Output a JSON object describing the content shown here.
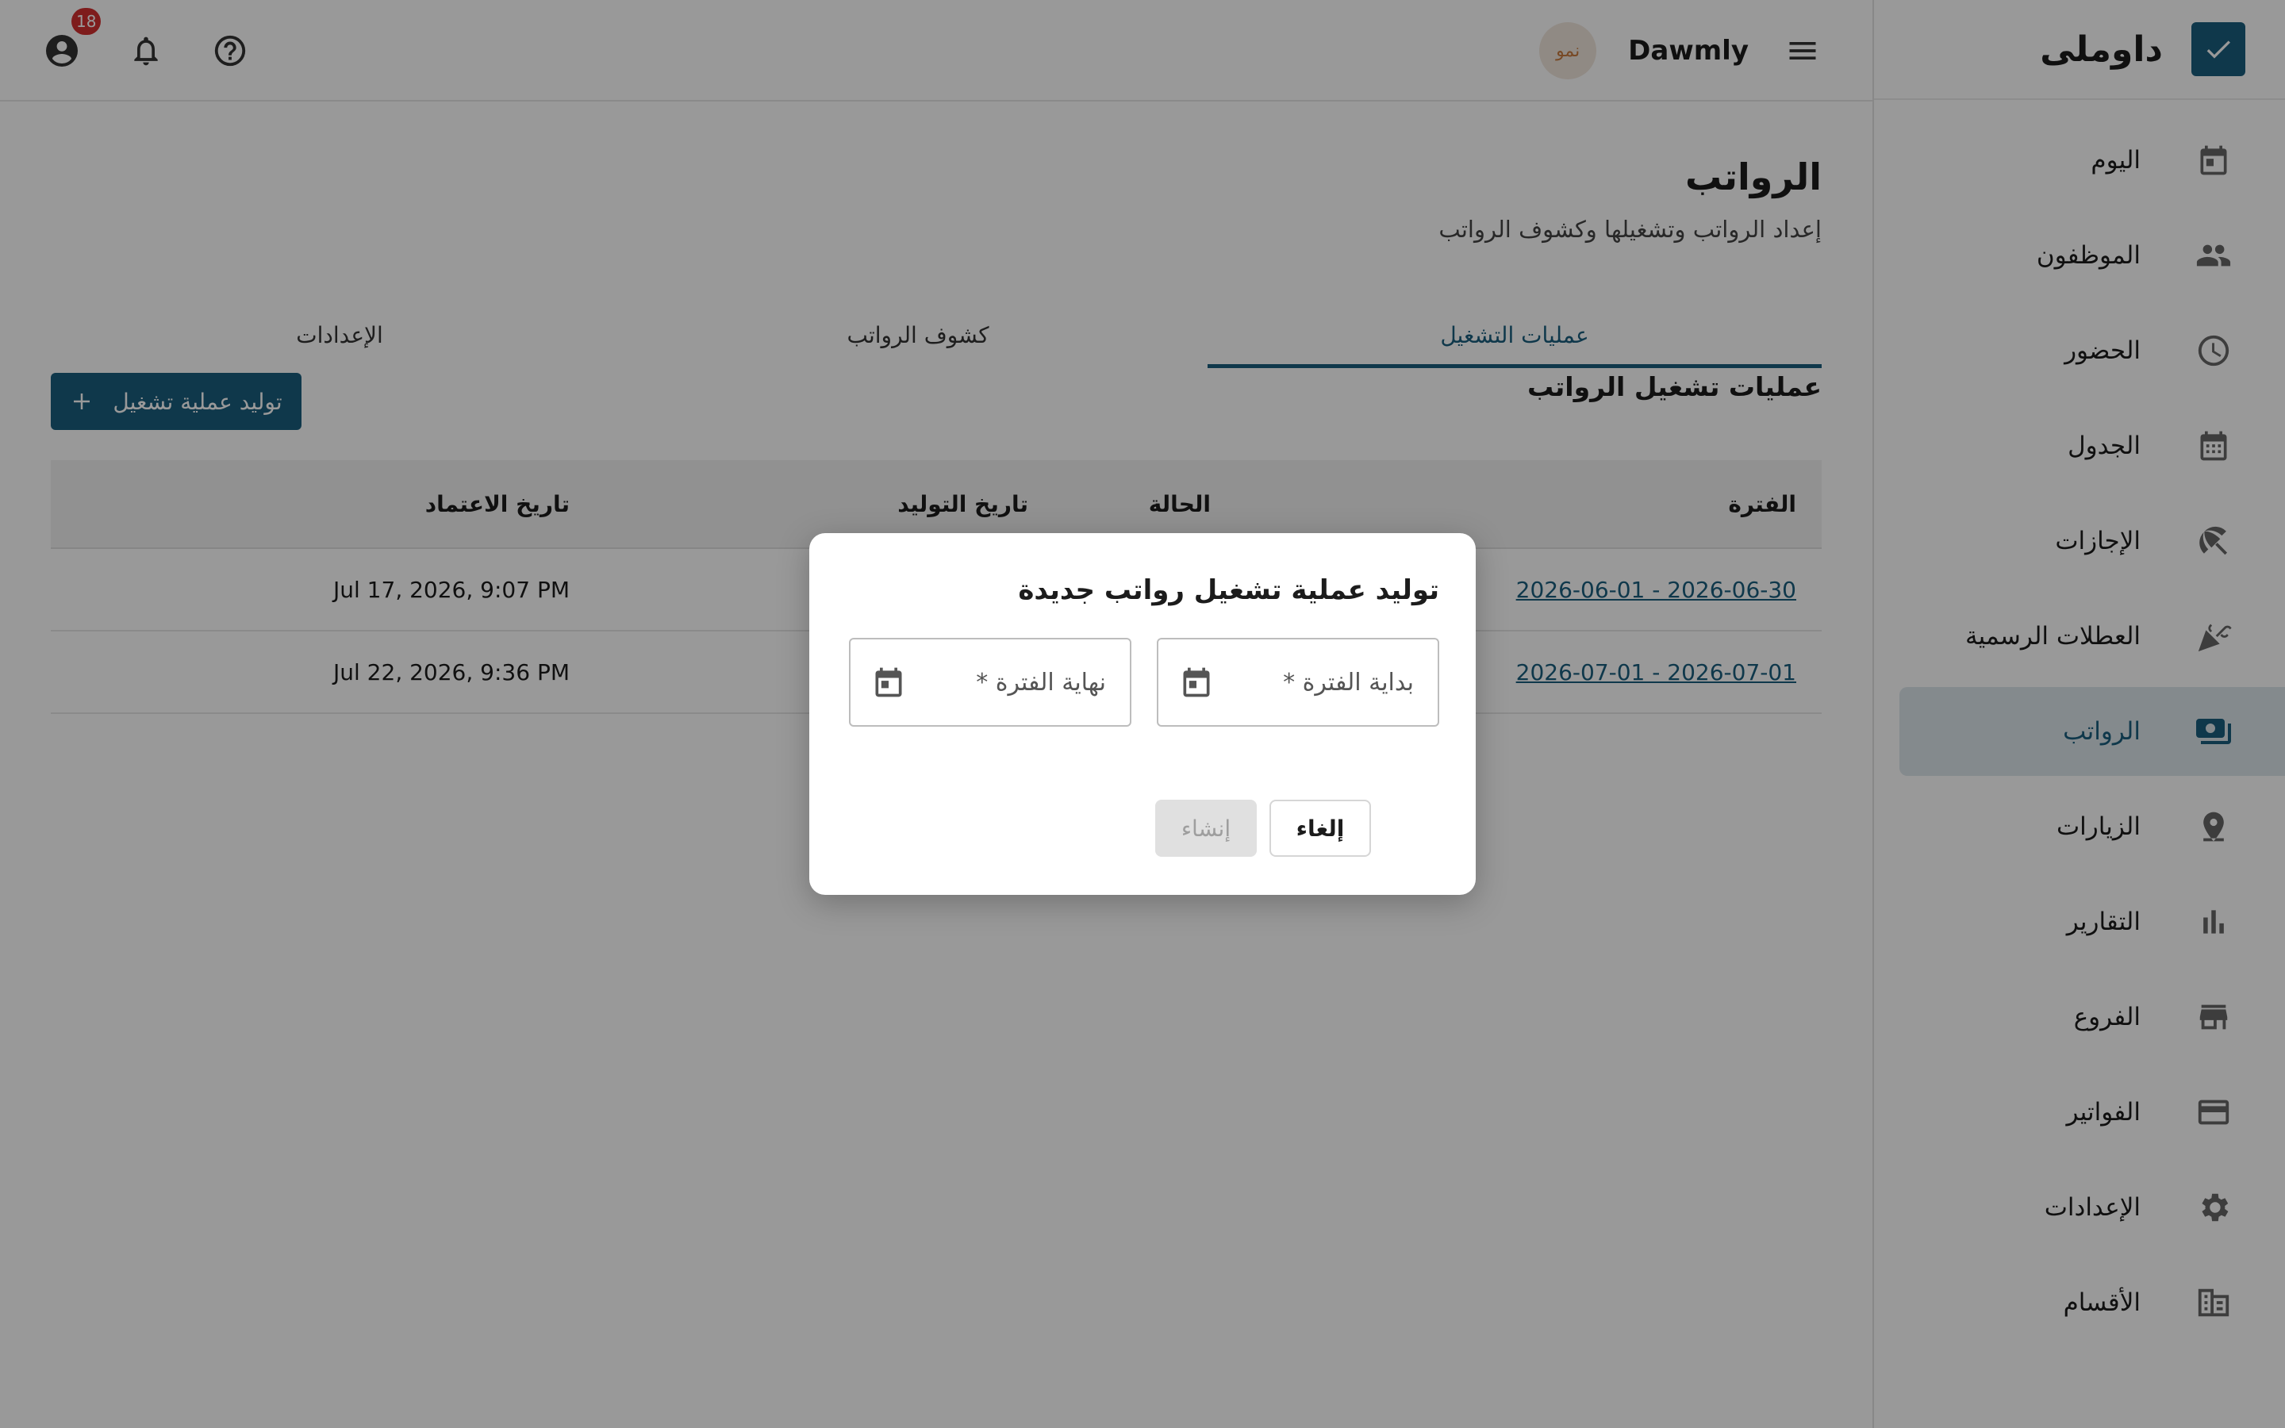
{
  "sidebar": {
    "brand": "داوملى",
    "items": [
      {
        "label": "اليوم",
        "icon": "calendar-today-icon"
      },
      {
        "label": "الموظفون",
        "icon": "people-icon"
      },
      {
        "label": "الحضور",
        "icon": "clock-icon"
      },
      {
        "label": "الجدول",
        "icon": "calendar-grid-icon"
      },
      {
        "label": "الإجازات",
        "icon": "beach-umbrella-icon"
      },
      {
        "label": "العطلات الرسمية",
        "icon": "celebration-icon"
      },
      {
        "label": "الرواتب",
        "icon": "payments-icon",
        "active": true
      },
      {
        "label": "الزيارات",
        "icon": "location-pin-icon"
      },
      {
        "label": "التقارير",
        "icon": "bar-chart-icon"
      },
      {
        "label": "الفروع",
        "icon": "store-icon"
      },
      {
        "label": "الفواتير",
        "icon": "credit-card-icon"
      },
      {
        "label": "الإعدادات",
        "icon": "gear-icon"
      },
      {
        "label": "الأقسام",
        "icon": "building-icon"
      }
    ]
  },
  "topbar": {
    "org_name": "Dawmly",
    "org_avatar_text": "نمو",
    "notification_count": "18"
  },
  "page": {
    "title": "الرواتب",
    "subtitle": "إعداد الرواتب وتشغيلها وكشوف الرواتب",
    "tabs": [
      {
        "label": "عمليات التشغيل",
        "active": true
      },
      {
        "label": "كشوف الرواتب"
      },
      {
        "label": "الإعدادات"
      }
    ],
    "section_title": "عمليات تشغيل الرواتب",
    "generate_button": "توليد عملية تشغيل"
  },
  "table": {
    "headers": {
      "period": "الفترة",
      "status": "الحالة",
      "generated": "تاريخ التوليد",
      "approved": "تاريخ الاعتماد"
    },
    "rows": [
      {
        "period": "2026-06-01 - 2026-06-30",
        "approved": "Jul 17, 2026, 9:07 PM"
      },
      {
        "period": "2026-07-01 - 2026-07-01",
        "approved": "Jul 22, 2026, 9:36 PM"
      }
    ]
  },
  "dialog": {
    "title": "توليد عملية تشغيل رواتب جديدة",
    "start_label": "بداية الفترة *",
    "end_label": "نهاية الفترة *",
    "cancel": "إلغاء",
    "create": "إنشاء"
  },
  "colors": {
    "primary": "#1a5e7e",
    "active_bg": "#dde6ec",
    "badge": "#d32f2f"
  }
}
